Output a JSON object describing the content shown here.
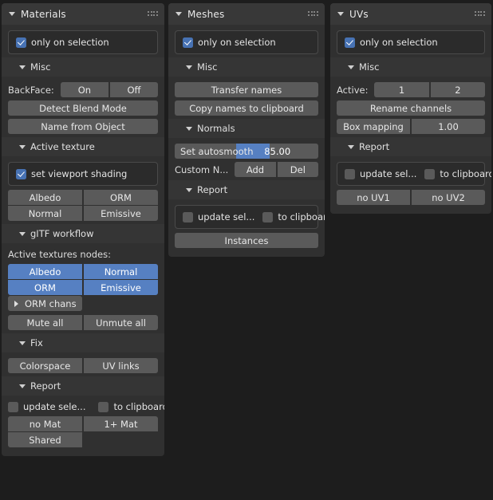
{
  "panels": {
    "materials": {
      "title": "Materials",
      "grip_icon": "drag-grip-icon",
      "only_on_selection": "only on selection",
      "sections": {
        "misc": {
          "title": "Misc",
          "backface_label": "BackFace:",
          "backface_on": "On",
          "backface_off": "Off",
          "detect_blend_mode": "Detect Blend Mode",
          "name_from_object": "Name from Object"
        },
        "active_texture": {
          "title": "Active texture",
          "set_viewport_shading": "set viewport shading",
          "albedo": "Albedo",
          "orm": "ORM",
          "normal": "Normal",
          "emissive": "Emissive"
        },
        "gltf_workflow": {
          "title": "gITF workflow",
          "active_textures_nodes_label": "Active textures nodes:",
          "albedo": "Albedo",
          "normal": "Normal",
          "orm": "ORM",
          "emissive": "Emissive",
          "orm_chans": "ORM chans",
          "mute_all": "Mute all",
          "unmute_all": "Unmute all"
        },
        "fix": {
          "title": "Fix",
          "colorspace": "Colorspace",
          "uv_links": "UV links"
        },
        "report": {
          "title": "Report",
          "update_selection": "update sele...",
          "to_clipboard": "to clipboard",
          "no_mat": "no Mat",
          "one_plus_mat": "1+ Mat",
          "shared": "Shared"
        }
      }
    },
    "meshes": {
      "title": "Meshes",
      "grip_icon": "drag-grip-icon",
      "only_on_selection": "only on selection",
      "sections": {
        "misc": {
          "title": "Misc",
          "transfer_names": "Transfer names",
          "copy_names_to_clipboard": "Copy names to clipboard"
        },
        "normals": {
          "title": "Normals",
          "set_autosmooth": "Set autosmooth",
          "autosmooth_value": "85.00",
          "custom_n_label": "Custom N...",
          "add": "Add",
          "del": "Del"
        },
        "report": {
          "title": "Report",
          "update_selection": "update sel...",
          "to_clipboard": "to clipboard",
          "instances": "Instances"
        }
      }
    },
    "uvs": {
      "title": "UVs",
      "grip_icon": "drag-grip-icon",
      "only_on_selection": "only on selection",
      "sections": {
        "misc": {
          "title": "Misc",
          "active_label": "Active:",
          "active_1": "1",
          "active_2": "2",
          "rename_channels": "Rename channels",
          "box_mapping": "Box mapping",
          "box_mapping_value": "1.00"
        },
        "report": {
          "title": "Report",
          "update_selection": "update sel...",
          "to_clipboard": "to clipboard",
          "no_uv1": "no UV1",
          "no_uv2": "no UV2"
        }
      }
    }
  },
  "colors": {
    "accent_blue": "#5680c2",
    "checkbox_blue": "#4772b3",
    "button_gray": "#5a5a5a",
    "panel_bg": "#303030",
    "header_bg": "#383838",
    "page_bg": "#1d1d1d"
  }
}
